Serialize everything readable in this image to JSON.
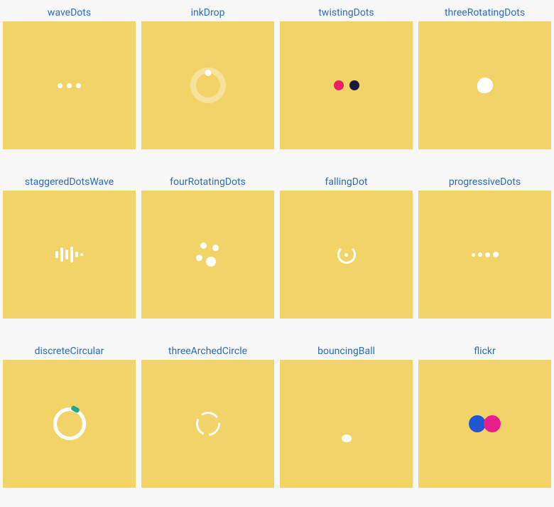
{
  "canvas_color": "#f2d367",
  "items": [
    {
      "key": "waveDots",
      "label": "waveDots"
    },
    {
      "key": "inkDrop",
      "label": "inkDrop"
    },
    {
      "key": "twistingDots",
      "label": "twistingDots",
      "dot1_color": "#e91e63",
      "dot2_color": "#1a1a3a"
    },
    {
      "key": "threeRotatingDots",
      "label": "threeRotatingDots"
    },
    {
      "key": "staggeredDotsWave",
      "label": "staggeredDotsWave"
    },
    {
      "key": "fourRotatingDots",
      "label": "fourRotatingDots"
    },
    {
      "key": "fallingDot",
      "label": "fallingDot"
    },
    {
      "key": "progressiveDots",
      "label": "progressiveDots"
    },
    {
      "key": "discreteCircular",
      "label": "discreteCircular",
      "accent_color": "#1aa88e"
    },
    {
      "key": "threeArchedCircle",
      "label": "threeArchedCircle"
    },
    {
      "key": "bouncingBall",
      "label": "bouncingBall"
    },
    {
      "key": "flickr",
      "label": "flickr",
      "dot1_color": "#1e56d6",
      "dot2_color": "#e91e8c"
    }
  ]
}
